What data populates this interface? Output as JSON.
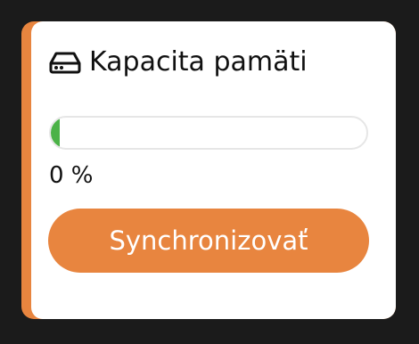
{
  "card": {
    "title": "Kapacita pamäti",
    "icon": "hard-drive-icon",
    "accent_color": "#e8853f"
  },
  "storage": {
    "percent_value": 0,
    "percent_label": "0 %",
    "fill_color": "#4bb247"
  },
  "actions": {
    "sync_label": "Synchronizovať"
  }
}
